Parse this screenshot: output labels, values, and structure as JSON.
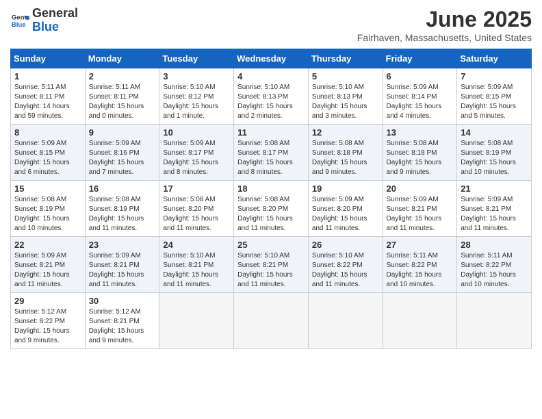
{
  "header": {
    "logo_general": "General",
    "logo_blue": "Blue",
    "month_title": "June 2025",
    "location": "Fairhaven, Massachusetts, United States"
  },
  "days_of_week": [
    "Sunday",
    "Monday",
    "Tuesday",
    "Wednesday",
    "Thursday",
    "Friday",
    "Saturday"
  ],
  "weeks": [
    [
      {
        "day": "1",
        "info": "Sunrise: 5:11 AM\nSunset: 8:11 PM\nDaylight: 14 hours\nand 59 minutes."
      },
      {
        "day": "2",
        "info": "Sunrise: 5:11 AM\nSunset: 8:11 PM\nDaylight: 15 hours\nand 0 minutes."
      },
      {
        "day": "3",
        "info": "Sunrise: 5:10 AM\nSunset: 8:12 PM\nDaylight: 15 hours\nand 1 minute."
      },
      {
        "day": "4",
        "info": "Sunrise: 5:10 AM\nSunset: 8:13 PM\nDaylight: 15 hours\nand 2 minutes."
      },
      {
        "day": "5",
        "info": "Sunrise: 5:10 AM\nSunset: 8:13 PM\nDaylight: 15 hours\nand 3 minutes."
      },
      {
        "day": "6",
        "info": "Sunrise: 5:09 AM\nSunset: 8:14 PM\nDaylight: 15 hours\nand 4 minutes."
      },
      {
        "day": "7",
        "info": "Sunrise: 5:09 AM\nSunset: 8:15 PM\nDaylight: 15 hours\nand 5 minutes."
      }
    ],
    [
      {
        "day": "8",
        "info": "Sunrise: 5:09 AM\nSunset: 8:15 PM\nDaylight: 15 hours\nand 6 minutes."
      },
      {
        "day": "9",
        "info": "Sunrise: 5:09 AM\nSunset: 8:16 PM\nDaylight: 15 hours\nand 7 minutes."
      },
      {
        "day": "10",
        "info": "Sunrise: 5:09 AM\nSunset: 8:17 PM\nDaylight: 15 hours\nand 8 minutes."
      },
      {
        "day": "11",
        "info": "Sunrise: 5:08 AM\nSunset: 8:17 PM\nDaylight: 15 hours\nand 8 minutes."
      },
      {
        "day": "12",
        "info": "Sunrise: 5:08 AM\nSunset: 8:18 PM\nDaylight: 15 hours\nand 9 minutes."
      },
      {
        "day": "13",
        "info": "Sunrise: 5:08 AM\nSunset: 8:18 PM\nDaylight: 15 hours\nand 9 minutes."
      },
      {
        "day": "14",
        "info": "Sunrise: 5:08 AM\nSunset: 8:19 PM\nDaylight: 15 hours\nand 10 minutes."
      }
    ],
    [
      {
        "day": "15",
        "info": "Sunrise: 5:08 AM\nSunset: 8:19 PM\nDaylight: 15 hours\nand 10 minutes."
      },
      {
        "day": "16",
        "info": "Sunrise: 5:08 AM\nSunset: 8:19 PM\nDaylight: 15 hours\nand 11 minutes."
      },
      {
        "day": "17",
        "info": "Sunrise: 5:08 AM\nSunset: 8:20 PM\nDaylight: 15 hours\nand 11 minutes."
      },
      {
        "day": "18",
        "info": "Sunrise: 5:08 AM\nSunset: 8:20 PM\nDaylight: 15 hours\nand 11 minutes."
      },
      {
        "day": "19",
        "info": "Sunrise: 5:09 AM\nSunset: 8:20 PM\nDaylight: 15 hours\nand 11 minutes."
      },
      {
        "day": "20",
        "info": "Sunrise: 5:09 AM\nSunset: 8:21 PM\nDaylight: 15 hours\nand 11 minutes."
      },
      {
        "day": "21",
        "info": "Sunrise: 5:09 AM\nSunset: 8:21 PM\nDaylight: 15 hours\nand 11 minutes."
      }
    ],
    [
      {
        "day": "22",
        "info": "Sunrise: 5:09 AM\nSunset: 8:21 PM\nDaylight: 15 hours\nand 11 minutes."
      },
      {
        "day": "23",
        "info": "Sunrise: 5:09 AM\nSunset: 8:21 PM\nDaylight: 15 hours\nand 11 minutes."
      },
      {
        "day": "24",
        "info": "Sunrise: 5:10 AM\nSunset: 8:21 PM\nDaylight: 15 hours\nand 11 minutes."
      },
      {
        "day": "25",
        "info": "Sunrise: 5:10 AM\nSunset: 8:21 PM\nDaylight: 15 hours\nand 11 minutes."
      },
      {
        "day": "26",
        "info": "Sunrise: 5:10 AM\nSunset: 8:22 PM\nDaylight: 15 hours\nand 11 minutes."
      },
      {
        "day": "27",
        "info": "Sunrise: 5:11 AM\nSunset: 8:22 PM\nDaylight: 15 hours\nand 10 minutes."
      },
      {
        "day": "28",
        "info": "Sunrise: 5:11 AM\nSunset: 8:22 PM\nDaylight: 15 hours\nand 10 minutes."
      }
    ],
    [
      {
        "day": "29",
        "info": "Sunrise: 5:12 AM\nSunset: 8:22 PM\nDaylight: 15 hours\nand 9 minutes."
      },
      {
        "day": "30",
        "info": "Sunrise: 5:12 AM\nSunset: 8:21 PM\nDaylight: 15 hours\nand 9 minutes."
      },
      {
        "day": "",
        "info": ""
      },
      {
        "day": "",
        "info": ""
      },
      {
        "day": "",
        "info": ""
      },
      {
        "day": "",
        "info": ""
      },
      {
        "day": "",
        "info": ""
      }
    ]
  ]
}
